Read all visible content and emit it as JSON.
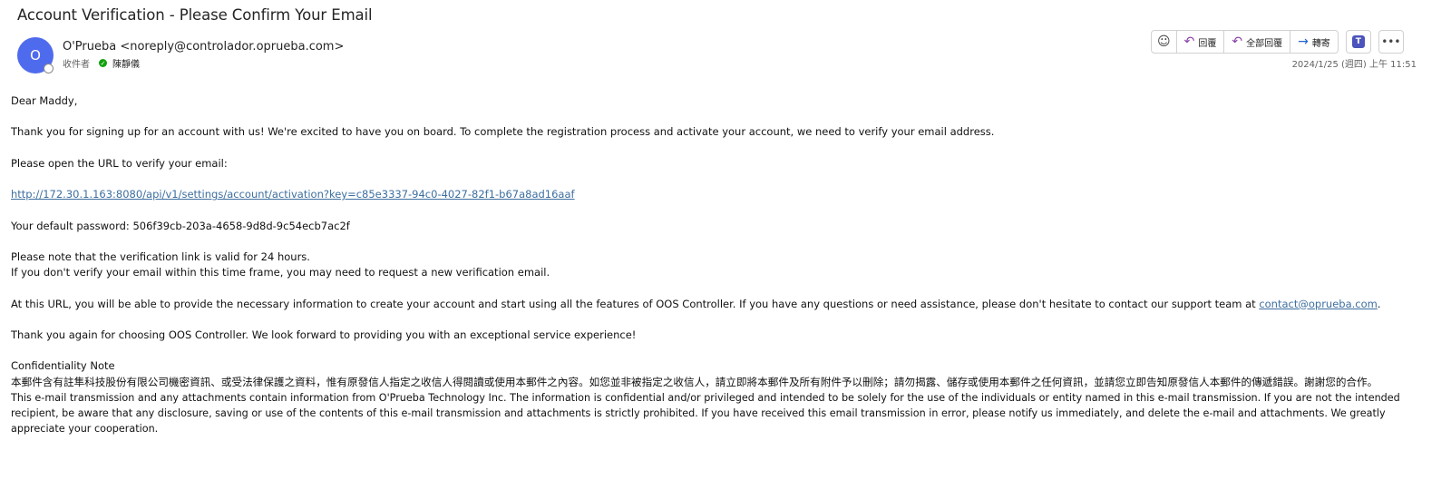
{
  "email": {
    "subject": "Account Verification - Please Confirm Your Email",
    "avatar_initial": "O",
    "sender": "O'Prueba <noreply@controlador.oprueba.com>",
    "to_label": "收件者",
    "recipient": "陳靜儀",
    "timestamp": "2024/1/25 (週四) 上午 11:51"
  },
  "toolbar": {
    "emoji_icon": "emoji-icon",
    "reply_label": "回覆",
    "reply_all_label": "全部回覆",
    "forward_label": "轉寄",
    "teams_icon": "teams-icon",
    "more_icon": "more-icon"
  },
  "body": {
    "greeting": "Dear Maddy,",
    "intro": "Thank you for signing up for an account with us! We're excited to have you on board. To complete the registration process and activate your account, we need to verify your email address.",
    "open_url": "Please open the URL to verify your email:",
    "activation_link": "http://172.30.1.163:8080/api/v1/settings/account/activation?key=c85e3337-94c0-4027-82f1-b67a8ad16aaf",
    "password_line": "Your default password: 506f39cb-203a-4658-9d8d-9c54ecb7ac2f",
    "valid_note": "Please note that the verification link is valid for 24 hours.",
    "expire_note": "If you don't verify your email within this time frame, you may need to request a new verification email.",
    "url_info_prefix": "At this URL, you will be able to provide the necessary information to create your account and start using all the features of OOS Controller. If you have any questions or need assistance, please don't hesitate to contact our support team at ",
    "support_email": "contact@oprueba.com",
    "url_info_suffix": ".",
    "thanks": "Thank you again for choosing OOS Controller. We look forward to providing you with an exceptional service experience!",
    "confidentiality_title": "Confidentiality Note",
    "confidentiality_zh": "本郵件含有註隼科技股份有限公司機密資訊、或受法律保護之資料，惟有原發信人指定之收信人得閱讀或使用本郵件之內容。如您並非被指定之收信人，請立即將本郵件及所有附件予以刪除；請勿揭露、儲存或使用本郵件之任何資訊，並請您立即告知原發信人本郵件的傳遞錯誤。謝謝您的合作。",
    "confidentiality_en": "This e-mail transmission and any attachments contain information from O'Prueba Technology Inc. The information is confidential and/or privileged and intended to be solely for the use of the individuals or entity named in this e-mail transmission. If you are not the intended recipient, be aware that any disclosure, saving or use of the contents of this e-mail transmission and attachments is strictly prohibited. If you have received this email transmission in error, please notify us immediately, and delete the e-mail and attachments. We greatly appreciate your cooperation."
  }
}
